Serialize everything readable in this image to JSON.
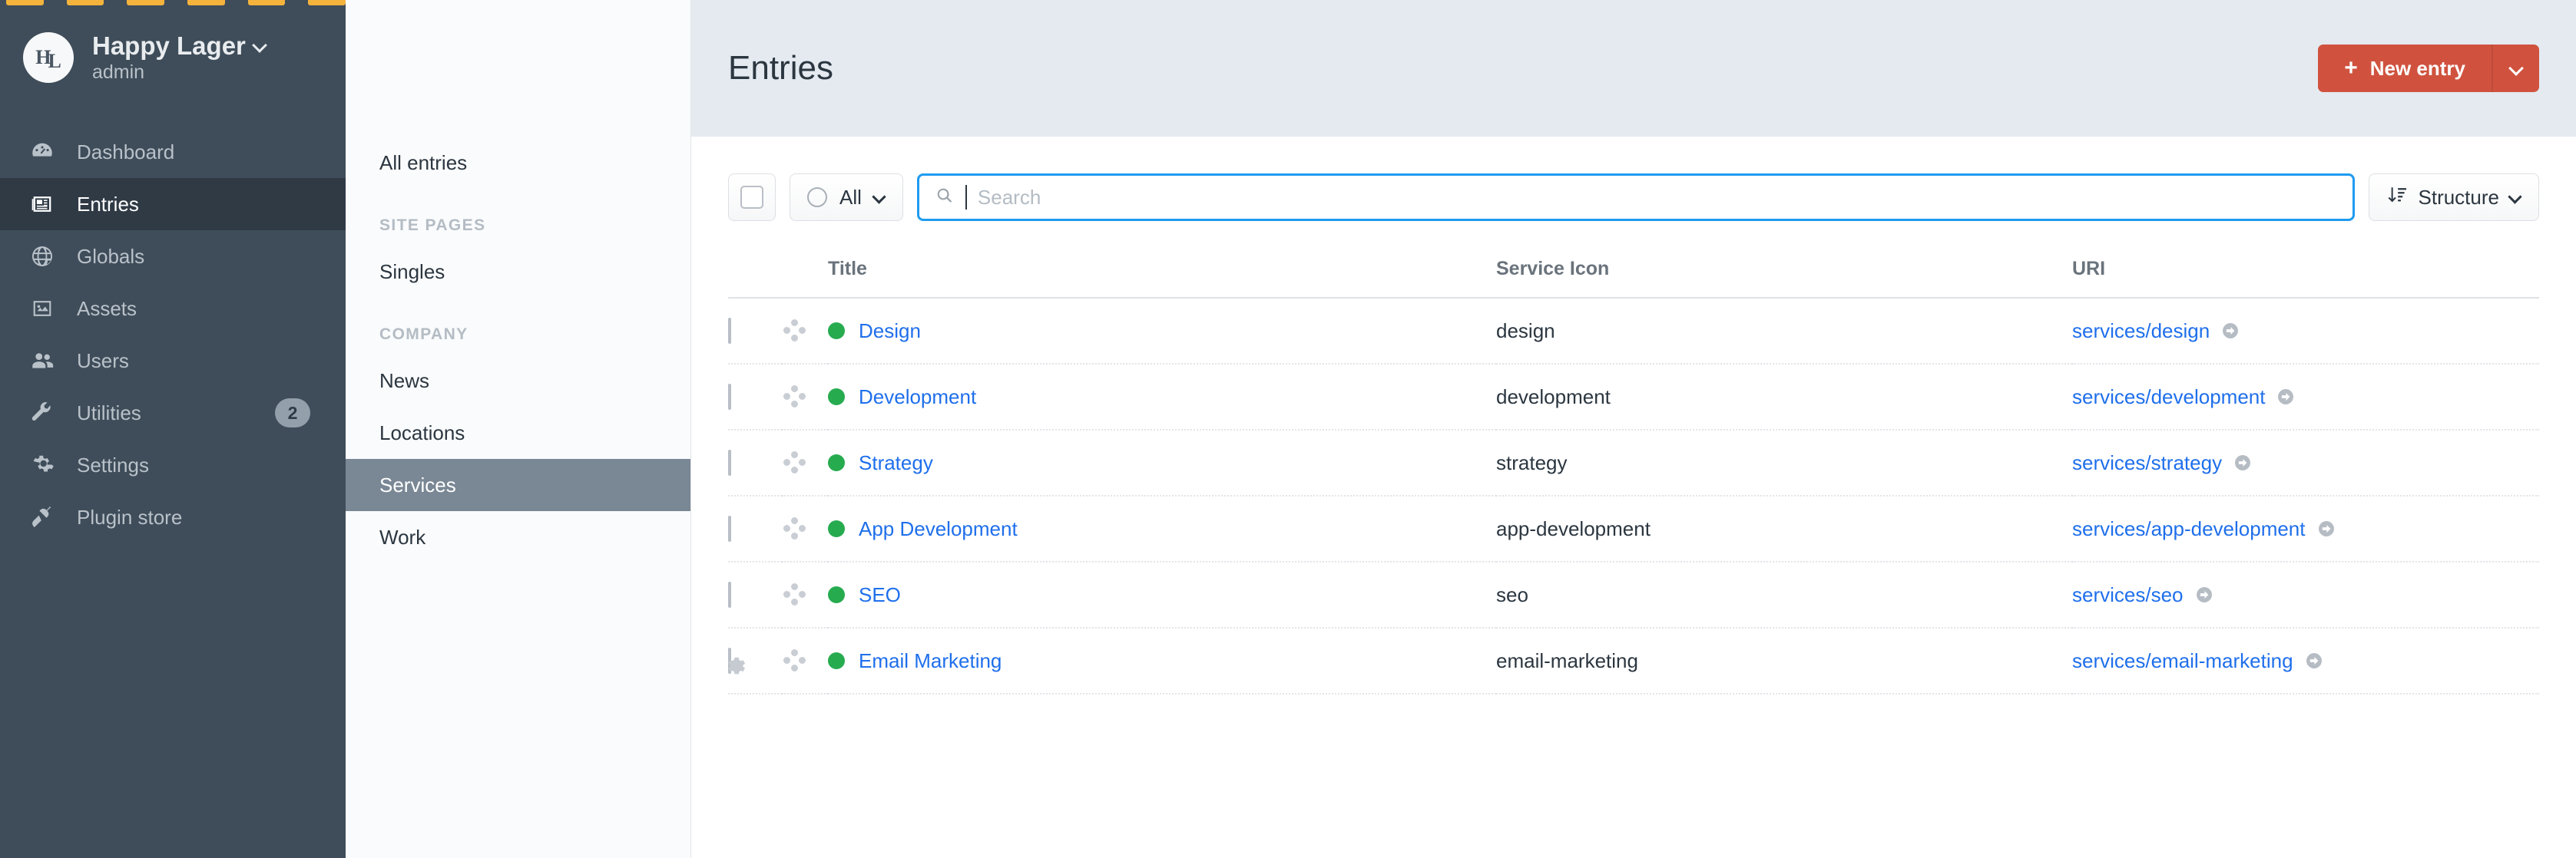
{
  "brand": {
    "logo_text": "HL",
    "name": "Happy Lager",
    "user": "admin"
  },
  "sidebar": {
    "items": [
      {
        "label": "Dashboard",
        "icon": "gauge-icon",
        "active": false,
        "badge": null
      },
      {
        "label": "Entries",
        "icon": "newspaper-icon",
        "active": true,
        "badge": null
      },
      {
        "label": "Globals",
        "icon": "globe-icon",
        "active": false,
        "badge": null
      },
      {
        "label": "Assets",
        "icon": "image-icon",
        "active": false,
        "badge": null
      },
      {
        "label": "Users",
        "icon": "users-icon",
        "active": false,
        "badge": null
      },
      {
        "label": "Utilities",
        "icon": "wrench-icon",
        "active": false,
        "badge": "2"
      },
      {
        "label": "Settings",
        "icon": "gear-icon",
        "active": false,
        "badge": null
      },
      {
        "label": "Plugin store",
        "icon": "plug-icon",
        "active": false,
        "badge": null
      }
    ]
  },
  "subnav": {
    "all_entries": "All entries",
    "groups": [
      {
        "heading": "SITE PAGES",
        "items": [
          {
            "label": "Singles",
            "active": false
          }
        ]
      },
      {
        "heading": "COMPANY",
        "items": [
          {
            "label": "News",
            "active": false
          },
          {
            "label": "Locations",
            "active": false
          },
          {
            "label": "Services",
            "active": true
          },
          {
            "label": "Work",
            "active": false
          }
        ]
      }
    ],
    "settings_icon": "gear-icon"
  },
  "header": {
    "title": "Entries",
    "new_entry_label": "New entry",
    "new_entry_plus": "+",
    "accent_color": "#d0523e"
  },
  "toolbar": {
    "select_all_name": "select-all-checkbox",
    "status_filter_label": "All",
    "search": {
      "value": "",
      "placeholder": "Search",
      "focused": true
    },
    "structure_label": "Structure"
  },
  "table": {
    "columns": [
      "Title",
      "Service Icon",
      "URI"
    ],
    "rows": [
      {
        "title": "Design",
        "status": "live",
        "service_icon": "design",
        "uri": "services/design"
      },
      {
        "title": "Development",
        "status": "live",
        "service_icon": "development",
        "uri": "services/development"
      },
      {
        "title": "Strategy",
        "status": "live",
        "service_icon": "strategy",
        "uri": "services/strategy"
      },
      {
        "title": "App Development",
        "status": "live",
        "service_icon": "app-development",
        "uri": "services/app-development"
      },
      {
        "title": "SEO",
        "status": "live",
        "service_icon": "seo",
        "uri": "services/seo"
      },
      {
        "title": "Email Marketing",
        "status": "live",
        "service_icon": "email-marketing",
        "uri": "services/email-marketing"
      }
    ]
  },
  "colors": {
    "sidebar_bg": "#3f4d5a",
    "sidebar_active": "#2f3a45",
    "header_bg": "#e4eaf0",
    "link": "#1f6feb",
    "status_live": "#27ab4f",
    "focus": "#1f9bf0",
    "tab_accent": "#f4b33d"
  }
}
